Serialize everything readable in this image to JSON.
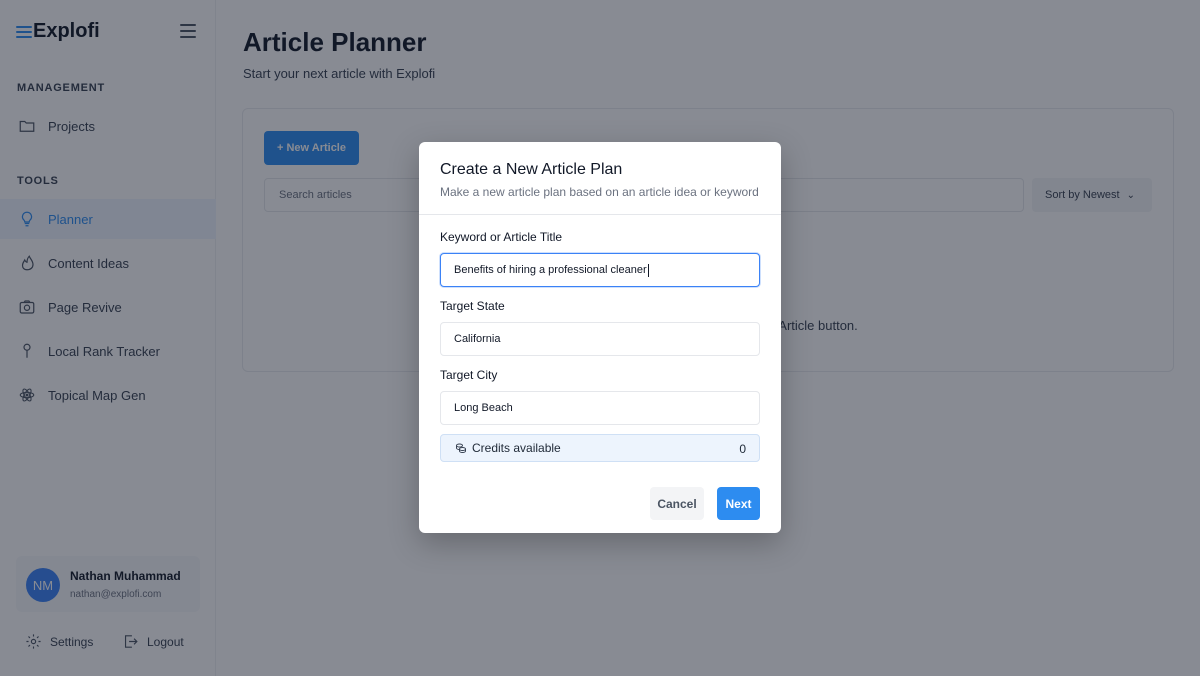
{
  "sidebar": {
    "logo_text": "Explofi",
    "management_label": "MANAGEMENT",
    "tools_label": "TOOLS",
    "items": [
      {
        "label": "Projects",
        "icon": "folder-icon"
      },
      {
        "label": "Planner",
        "icon": "lightbulb-icon",
        "active": true
      },
      {
        "label": "Content Ideas",
        "icon": "flame-icon"
      },
      {
        "label": "Page Revive",
        "icon": "camera-icon"
      },
      {
        "label": "Local Rank Tracker",
        "icon": "map-pin-icon"
      },
      {
        "label": "Topical Map Gen",
        "icon": "atom-icon"
      }
    ],
    "user": {
      "initials": "NM",
      "name": "Nathan Muhammad",
      "email": "nathan@explofi.com"
    },
    "settings_label": "Settings",
    "logout_label": "Logout"
  },
  "main": {
    "title": "Article Planner",
    "subtitle": "Start your next article with Explofi",
    "new_article_label": "+ New Article",
    "search_placeholder": "Search articles",
    "sort_label": "Sort by Newest",
    "empty_text": "w Article button."
  },
  "modal": {
    "title": "Create a New Article Plan",
    "subtitle": "Make a new article plan based on an article idea or keyword",
    "keyword_label": "Keyword or Article Title",
    "keyword_value": "Benefits of hiring a professional cleaner",
    "state_label": "Target State",
    "state_value": "California",
    "city_label": "Target City",
    "city_value": "Long Beach",
    "credits_label": "Credits available",
    "credits_value": "0",
    "cancel_label": "Cancel",
    "next_label": "Next"
  },
  "colors": {
    "accent": "#2d8cf0",
    "overlay": "rgba(17,24,39,0.5)",
    "credits_bg": "#edf4fd"
  }
}
